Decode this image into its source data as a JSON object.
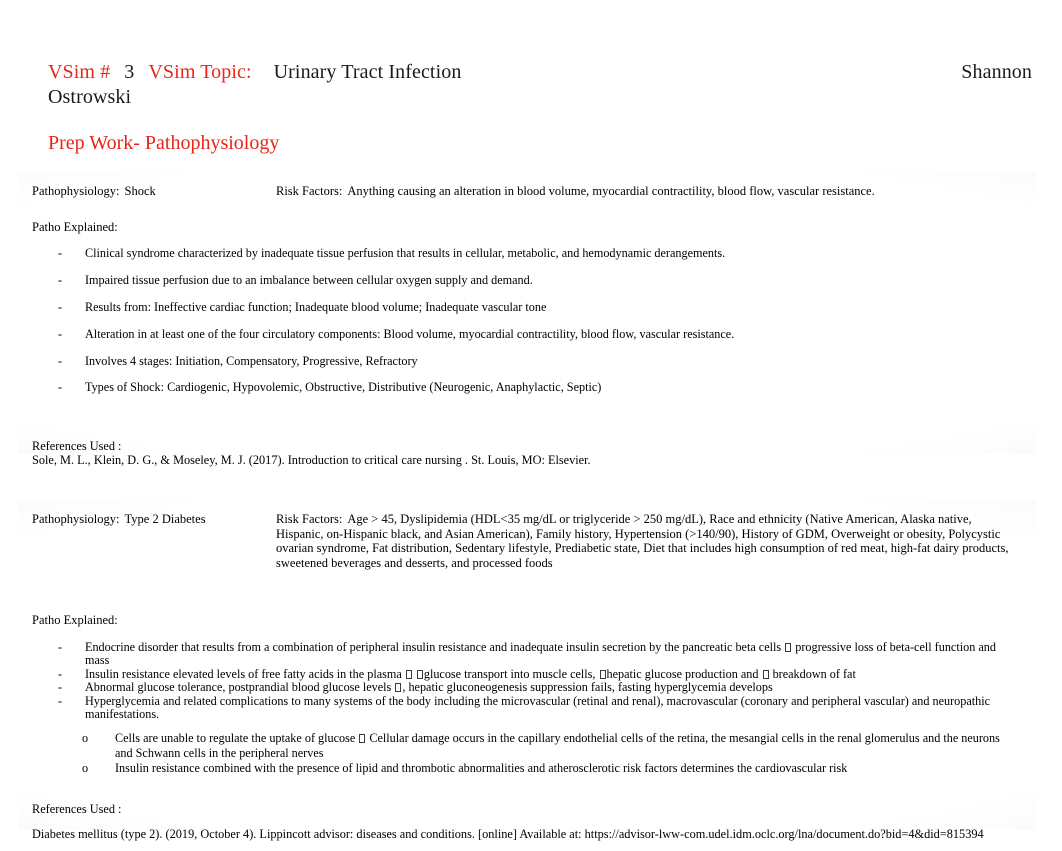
{
  "header": {
    "vsim_label": "VSim #",
    "vsim_number": "3",
    "topic_label": "VSim Topic:",
    "topic_value": "Urinary Tract Infection",
    "student_first": "Shannon",
    "student_last": "Ostrowski",
    "subtitle": "Prep Work- Pathophysiology",
    "accent_color": "#e8251a",
    "text_color": "#1a1a1a"
  },
  "panels": [
    {
      "id": "shock",
      "patho_label": "Pathophysiology:",
      "patho_value": "Shock",
      "risk_label": "Risk Factors:",
      "risk_value": "Anything causing an alteration in blood volume, myocardial contractility, blood flow, vascular resistance.",
      "patho_explained_label": "Patho Explained:",
      "bullets": [
        "Clinical syndrome characterized by inadequate tissue perfusion that results in cellular, metabolic, and hemodynamic derangements.",
        "Impaired tissue perfusion due to an imbalance between cellular oxygen supply and demand.",
        "Results from: Ineffective cardiac function; Inadequate blood volume; Inadequate vascular tone",
        "Alteration in at least one of the four circulatory components: Blood volume, myocardial contractility, blood flow, vascular resistance.",
        "Involves 4 stages: Initiation, Compensatory, Progressive, Refractory",
        "Types of Shock: Cardiogenic, Hypovolemic, Obstructive, Distributive (Neurogenic, Anaphylactic, Septic)"
      ],
      "references_label": "References Used :",
      "references_text": "Sole, M. L., Klein, D. G., & Moseley, M. J. (2017).  Introduction to critical care nursing . St. Louis, MO: Elsevier."
    },
    {
      "id": "diabetes",
      "patho_label": "Pathophysiology:",
      "patho_value": "Type 2 Diabetes",
      "risk_label": "Risk Factors:",
      "risk_value": "Age > 45, Dyslipidemia (HDL<35 mg/dL or triglyceride > 250 mg/dL), Race and ethnicity (Native American, Alaska native, Hispanic, on-Hispanic black, and Asian American), Family history, Hypertension (>140/90), History of GDM, Overweight or obesity, Polycystic ovarian syndrome, Fat distribution, Sedentary lifestyle, Prediabetic state, Diet that includes high consumption of red meat, high-fat dairy products, sweetened beverages and desserts, and processed foods",
      "patho_explained_label": "Patho Explained:",
      "bullets": [
        {
          "parts": [
            "Endocrine disorder that results from a combination of peripheral insulin resistance and inadequate insulin secretion by the pancreatic beta cells ",
            "TOFU",
            "  progressive loss of beta-cell function and mass"
          ]
        },
        {
          "parts": [
            "Insulin resistance elevated levels of free fatty acids in the plasma ",
            "TOFU",
            " ",
            "TOFU",
            "glucose transport into muscle cells, ",
            "TOFU",
            "hepatic glucose production and ",
            "TOFU",
            " breakdown of fat"
          ]
        },
        {
          "parts": [
            "Abnormal glucose tolerance, postprandial blood glucose levels ",
            "TOFU",
            ", hepatic gluconeogenesis suppression fails, fasting hyperglycemia develops"
          ]
        },
        {
          "parts": [
            "Hyperglycemia and related complications to many systems of the body including the microvascular (retinal and renal), macrovascular (coronary and peripheral vascular) and neuropathic manifestations."
          ]
        }
      ],
      "sub_bullets": [
        {
          "parts": [
            "Cells are unable to regulate the uptake of glucose ",
            "TOFU",
            "  Cellular damage occurs in the capillary endothelial cells of the retina, the mesangial cells in the renal glomerulus and the neurons and Schwann cells in the peripheral nerves"
          ]
        },
        {
          "parts": [
            "Insulin resistance combined with the presence of lipid and thrombotic abnormalities and atherosclerotic risk factors determines the cardiovascular risk"
          ]
        }
      ],
      "references_label": "References Used :",
      "references_text": "Diabetes mellitus (type 2). (2019, October 4).  Lippincott advisor: diseases and conditions. [online] Available at: https://advisor-lww-com.udel.idm.oclc.org/lna/document.do?bid=4&did=815394"
    }
  ],
  "markers": {
    "dash": "-",
    "circle": "o"
  }
}
